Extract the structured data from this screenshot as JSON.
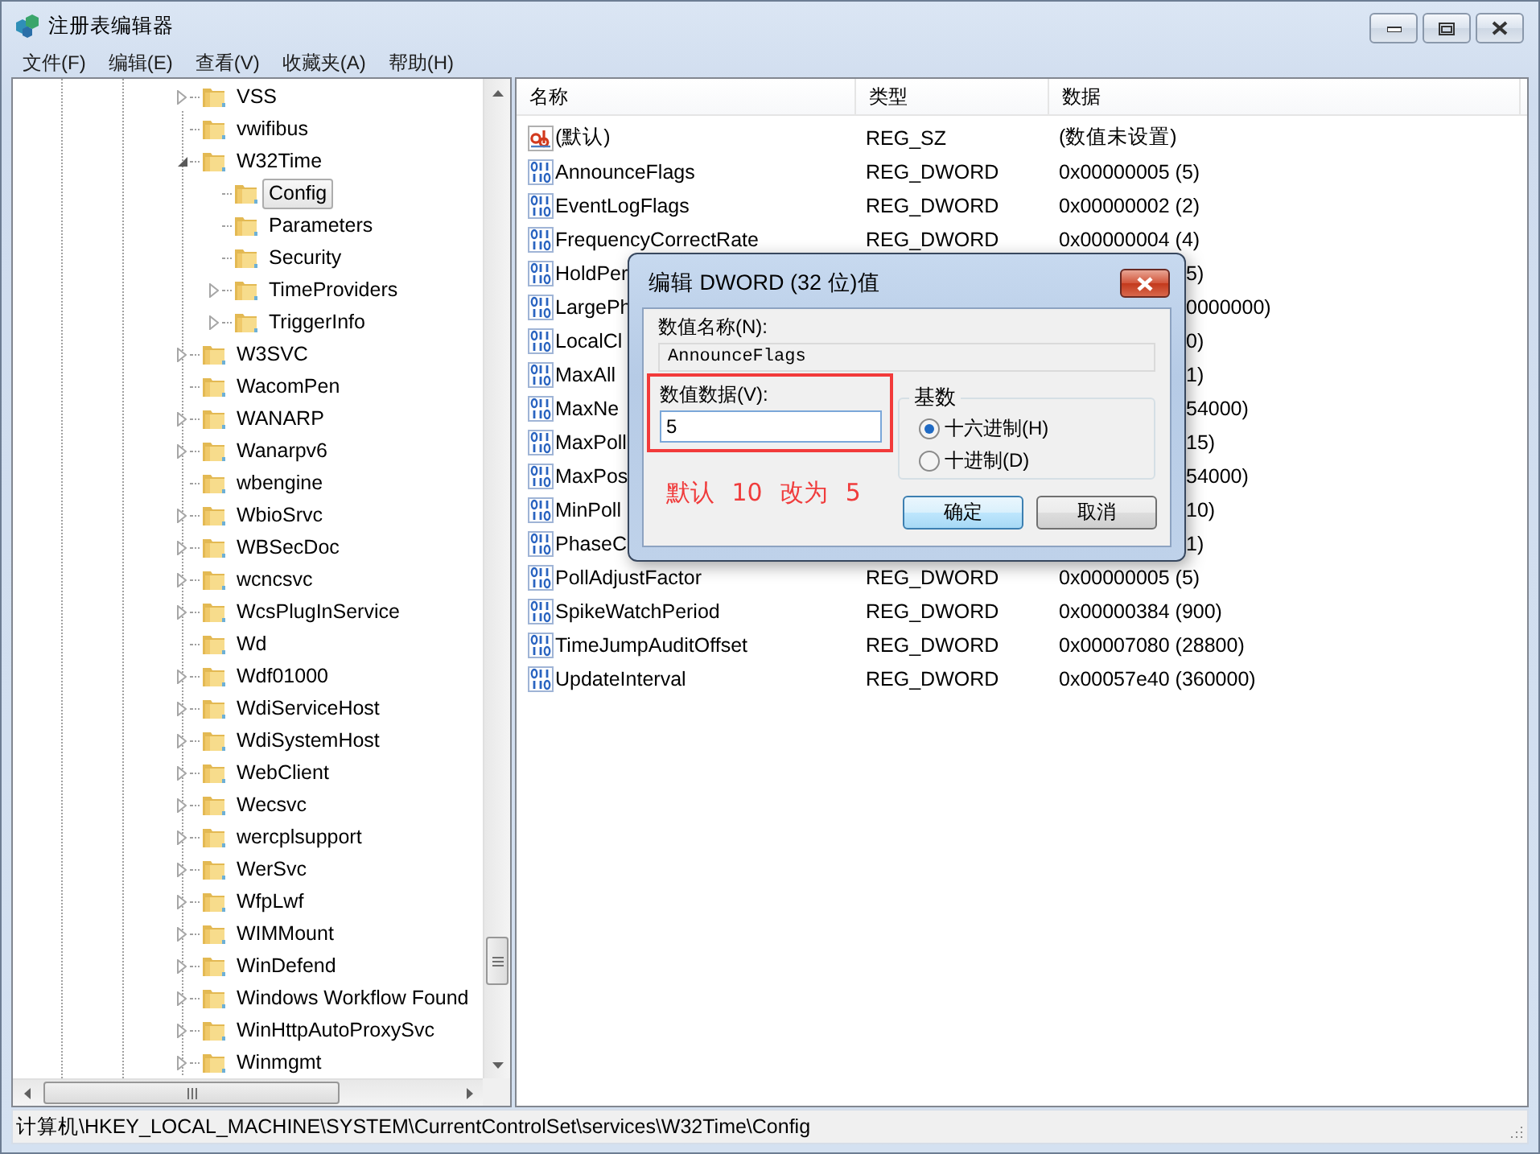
{
  "window": {
    "title": "注册表编辑器"
  },
  "menu": [
    {
      "label": "文件(F)"
    },
    {
      "label": "编辑(E)"
    },
    {
      "label": "查看(V)"
    },
    {
      "label": "收藏夹(A)"
    },
    {
      "label": "帮助(H)"
    }
  ],
  "tree": {
    "items": [
      {
        "label": "VSS",
        "expandable": true,
        "expanded": false,
        "selected": false
      },
      {
        "label": "vwifibus",
        "expandable": false,
        "selected": false
      },
      {
        "label": "W32Time",
        "expandable": true,
        "expanded": true,
        "selected": false,
        "children": [
          {
            "label": "Config",
            "expandable": false,
            "selected": true
          },
          {
            "label": "Parameters",
            "expandable": false,
            "selected": false
          },
          {
            "label": "Security",
            "expandable": false,
            "selected": false
          },
          {
            "label": "TimeProviders",
            "expandable": true,
            "expanded": false,
            "selected": false
          },
          {
            "label": "TriggerInfo",
            "expandable": true,
            "expanded": false,
            "selected": false
          }
        ]
      },
      {
        "label": "W3SVC",
        "expandable": true,
        "expanded": false,
        "selected": false
      },
      {
        "label": "WacomPen",
        "expandable": false,
        "selected": false
      },
      {
        "label": "WANARP",
        "expandable": true,
        "expanded": false,
        "selected": false
      },
      {
        "label": "Wanarpv6",
        "expandable": true,
        "expanded": false,
        "selected": false
      },
      {
        "label": "wbengine",
        "expandable": false,
        "selected": false
      },
      {
        "label": "WbioSrvc",
        "expandable": true,
        "expanded": false,
        "selected": false
      },
      {
        "label": "WBSecDoc",
        "expandable": true,
        "expanded": false,
        "selected": false
      },
      {
        "label": "wcncsvc",
        "expandable": true,
        "expanded": false,
        "selected": false
      },
      {
        "label": "WcsPlugInService",
        "expandable": true,
        "expanded": false,
        "selected": false
      },
      {
        "label": "Wd",
        "expandable": false,
        "selected": false
      },
      {
        "label": "Wdf01000",
        "expandable": true,
        "expanded": false,
        "selected": false
      },
      {
        "label": "WdiServiceHost",
        "expandable": true,
        "expanded": false,
        "selected": false
      },
      {
        "label": "WdiSystemHost",
        "expandable": true,
        "expanded": false,
        "selected": false
      },
      {
        "label": "WebClient",
        "expandable": true,
        "expanded": false,
        "selected": false
      },
      {
        "label": "Wecsvc",
        "expandable": true,
        "expanded": false,
        "selected": false
      },
      {
        "label": "wercplsupport",
        "expandable": true,
        "expanded": false,
        "selected": false
      },
      {
        "label": "WerSvc",
        "expandable": true,
        "expanded": false,
        "selected": false
      },
      {
        "label": "WfpLwf",
        "expandable": true,
        "expanded": false,
        "selected": false
      },
      {
        "label": "WIMMount",
        "expandable": true,
        "expanded": false,
        "selected": false
      },
      {
        "label": "WinDefend",
        "expandable": true,
        "expanded": false,
        "selected": false
      },
      {
        "label": "Windows Workflow Found",
        "expandable": true,
        "expanded": false,
        "selected": false
      },
      {
        "label": "WinHttpAutoProxySvc",
        "expandable": true,
        "expanded": false,
        "selected": false
      },
      {
        "label": "Winmgmt",
        "expandable": true,
        "expanded": false,
        "selected": false
      }
    ]
  },
  "table": {
    "columns": [
      "名称",
      "类型",
      "数据"
    ],
    "rows": [
      {
        "kind": "string",
        "name": "(默认)",
        "type": "REG_SZ",
        "data": "(数值未设置)"
      },
      {
        "kind": "dword",
        "name": "AnnounceFlags",
        "type": "REG_DWORD",
        "data": "0x00000005 (5)"
      },
      {
        "kind": "dword",
        "name": "EventLogFlags",
        "type": "REG_DWORD",
        "data": "0x00000002 (2)"
      },
      {
        "kind": "dword",
        "name": "FrequencyCorrectRate",
        "type": "REG_DWORD",
        "data": "0x00000004 (4)"
      },
      {
        "kind": "dword",
        "name": "HoldPer",
        "data": "5)"
      },
      {
        "kind": "dword",
        "name": "LargePh",
        "data": "0000000)"
      },
      {
        "kind": "dword",
        "name": "LocalCl",
        "data": "0)"
      },
      {
        "kind": "dword",
        "name": "MaxAll",
        "data": "1)"
      },
      {
        "kind": "dword",
        "name": "MaxNe",
        "data": "54000)"
      },
      {
        "kind": "dword",
        "name": "MaxPoll",
        "data": "15)"
      },
      {
        "kind": "dword",
        "name": "MaxPos",
        "data": "54000)"
      },
      {
        "kind": "dword",
        "name": "MinPoll",
        "data": "10)"
      },
      {
        "kind": "dword",
        "name": "PhaseC",
        "data": "1)"
      },
      {
        "kind": "dword",
        "name": "PollAdjustFactor",
        "type": "REG_DWORD",
        "data": "0x00000005 (5)"
      },
      {
        "kind": "dword",
        "name": "SpikeWatchPeriod",
        "type": "REG_DWORD",
        "data": "0x00000384 (900)"
      },
      {
        "kind": "dword",
        "name": "TimeJumpAuditOffset",
        "type": "REG_DWORD",
        "data": "0x00007080 (28800)"
      },
      {
        "kind": "dword",
        "name": "UpdateInterval",
        "type": "REG_DWORD",
        "data": "0x00057e40 (360000)"
      }
    ]
  },
  "dialog": {
    "title": "编辑 DWORD (32 位)值",
    "name_label": "数值名称(N):",
    "name_value": "AnnounceFlags",
    "data_label": "数值数据(V):",
    "data_value": "5",
    "base_label": "基数",
    "bases": [
      {
        "label": "十六进制(H)",
        "selected": true
      },
      {
        "label": "十进制(D)",
        "selected": false
      }
    ],
    "annotation": "默认 10 改为 5",
    "buttons": [
      {
        "label": "确定",
        "default": true
      },
      {
        "label": "取消",
        "default": false
      }
    ]
  },
  "status_bar": {
    "path": "计算机\\HKEY_LOCAL_MACHINE\\SYSTEM\\CurrentControlSet\\services\\W32Time\\Config"
  }
}
